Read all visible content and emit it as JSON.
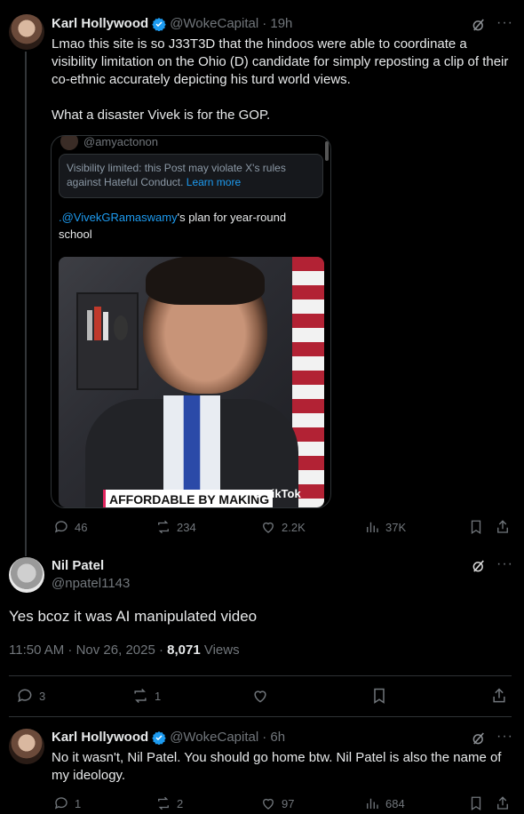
{
  "post1": {
    "name": "Karl Hollywood",
    "handle": "@WokeCapital",
    "time": "· 19h",
    "text": "Lmao this site is so J33T3D that the hindoos were able to coordinate a visibility limitation on the Ohio (D) candidate for simply reposting a clip of their co-ethnic accurately depicting his turd world views.",
    "text2": "What a disaster Vivek is for the GOP.",
    "quote": {
      "handle": "@amyactonon",
      "notice": "Visibility limited: this Post may violate X's rules against Hateful Conduct.",
      "learn_more": "Learn more",
      "mention": ".@VivekGRamaswamy",
      "text": "'s plan for year-round school",
      "video_caption": "AFFORDABLE BY MAKING",
      "tiktok": "TikTok"
    },
    "actions": {
      "replies": "46",
      "reposts": "234",
      "likes": "2.2K",
      "views": "37K"
    }
  },
  "post2": {
    "name": "Nil Patel",
    "handle": "@npatel1143",
    "text": "Yes bcoz it was AI manipulated video",
    "timestamp": "11:50 AM · Nov 26, 2025 · ",
    "views_count": "8,071",
    "views_label": " Views",
    "actions": {
      "replies": "3",
      "reposts": "1"
    }
  },
  "post3": {
    "name": "Karl Hollywood",
    "handle": "@WokeCapital",
    "time": "· 6h",
    "text": "No it wasn't, Nil Patel. You should go home btw. Nil Patel is also the name of my ideology.",
    "actions": {
      "replies": "1",
      "reposts": "2",
      "likes": "97",
      "views": "684"
    }
  },
  "icons": {
    "grok": "grok-icon",
    "more": "more-icon",
    "accent": "#1d9bf0"
  }
}
